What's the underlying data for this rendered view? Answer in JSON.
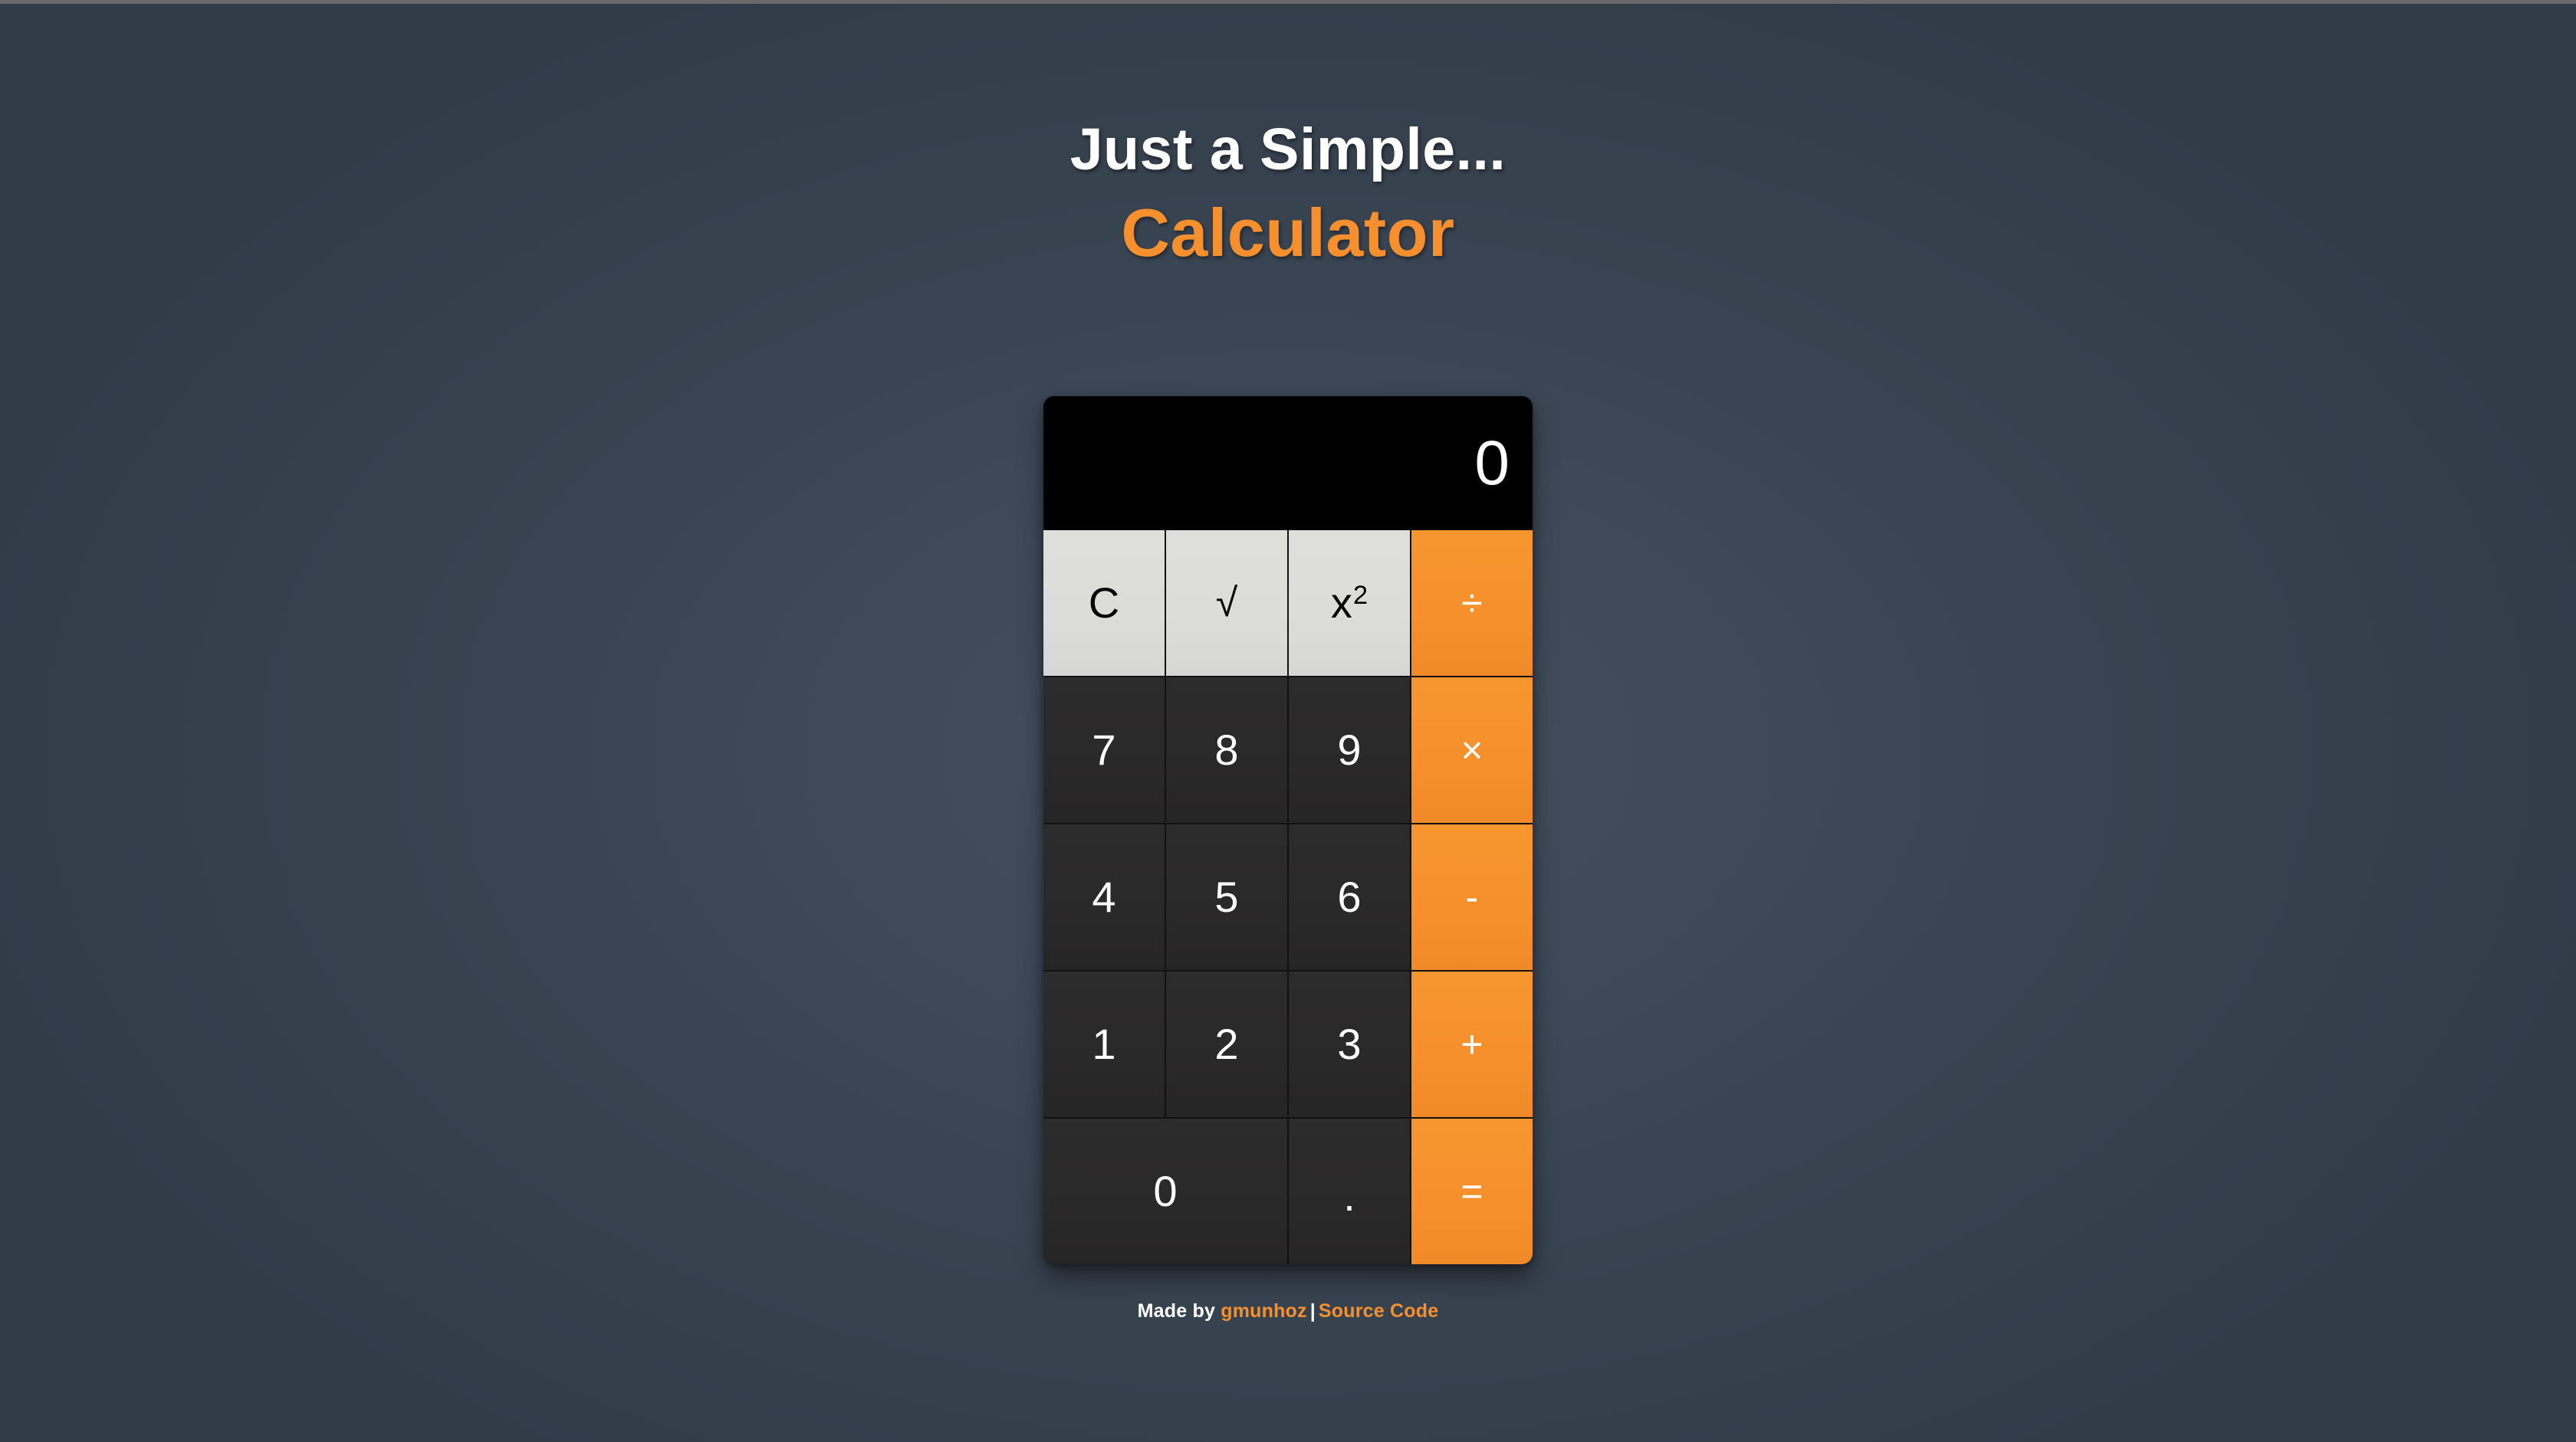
{
  "page": {
    "background_color": "#36414f",
    "accent_color": "#f6902f"
  },
  "header": {
    "title_line1": "Just a Simple...",
    "title_line2": "Calculator"
  },
  "calculator": {
    "display": {
      "value": "0"
    },
    "keys": [
      {
        "label": "C",
        "name": "clear-key",
        "style": "light",
        "glyph": "text"
      },
      {
        "label": "√",
        "name": "square-root-key",
        "style": "light",
        "glyph": "radical"
      },
      {
        "label": "x",
        "sup": "2",
        "name": "square-key",
        "style": "light",
        "glyph": "power"
      },
      {
        "label": "÷",
        "name": "divide-key",
        "style": "accent",
        "glyph": "op"
      },
      {
        "label": "7",
        "name": "digit-7-key",
        "style": "dark",
        "glyph": "text"
      },
      {
        "label": "8",
        "name": "digit-8-key",
        "style": "dark",
        "glyph": "text"
      },
      {
        "label": "9",
        "name": "digit-9-key",
        "style": "dark",
        "glyph": "text"
      },
      {
        "label": "×",
        "name": "multiply-key",
        "style": "accent",
        "glyph": "op"
      },
      {
        "label": "4",
        "name": "digit-4-key",
        "style": "dark",
        "glyph": "text"
      },
      {
        "label": "5",
        "name": "digit-5-key",
        "style": "dark",
        "glyph": "text"
      },
      {
        "label": "6",
        "name": "digit-6-key",
        "style": "dark",
        "glyph": "text"
      },
      {
        "label": "-",
        "name": "subtract-key",
        "style": "accent",
        "glyph": "op"
      },
      {
        "label": "1",
        "name": "digit-1-key",
        "style": "dark",
        "glyph": "text"
      },
      {
        "label": "2",
        "name": "digit-2-key",
        "style": "dark",
        "glyph": "text"
      },
      {
        "label": "3",
        "name": "digit-3-key",
        "style": "dark",
        "glyph": "text"
      },
      {
        "label": "+",
        "name": "add-key",
        "style": "accent",
        "glyph": "op"
      },
      {
        "label": "0",
        "name": "digit-0-key",
        "style": "dark",
        "glyph": "text",
        "wide": true
      },
      {
        "label": ".",
        "name": "decimal-point-key",
        "style": "dark",
        "glyph": "dot"
      },
      {
        "label": "=",
        "name": "equals-key",
        "style": "accent",
        "glyph": "op"
      }
    ]
  },
  "footer": {
    "made_by_text": "Made by ",
    "author": "gmunhoz",
    "separator": "|",
    "source_link": "Source Code"
  }
}
